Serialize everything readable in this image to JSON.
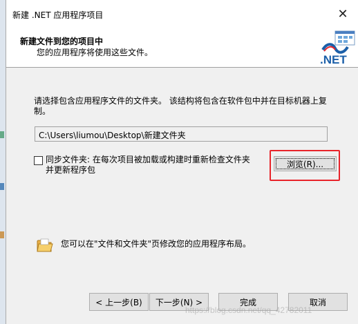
{
  "window": {
    "title": "新建 .NET 应用程序项目",
    "close_glyph": "✕"
  },
  "header": {
    "title": "新建文件到您的项目中",
    "subtitle": "您的应用程序将使用这些文件。",
    "logo_text": ".NET"
  },
  "content": {
    "instruction": "请选择包含应用程序文件的文件夹。 该结构将包含在软件包中并在目标机器上复制。",
    "path_value": "C:\\Users\\liumou\\Desktop\\新建文件夹",
    "sync_checked": false,
    "sync_label": "同步文件夹: 在每次项目被加载或构建时重新检查文件夹并更新程序包",
    "browse_label": "浏览(R)...",
    "tip_text": "您可以在\"文件和文件夹\"页修改您的应用程序布局。",
    "tip_icon": "folder-icon"
  },
  "footer": {
    "prev_label": "< 上一步(B)",
    "next_label": "下一步(N) >",
    "finish_label": "完成",
    "cancel_label": "取消"
  },
  "watermark": "https://blog.csdn.net/qq_42782011",
  "colors": {
    "highlight": "#e8232a",
    "dialog_bg": "#f0f0f0",
    "button_bg": "#e1e1e1",
    "net_blue": "#1b5fa8"
  }
}
